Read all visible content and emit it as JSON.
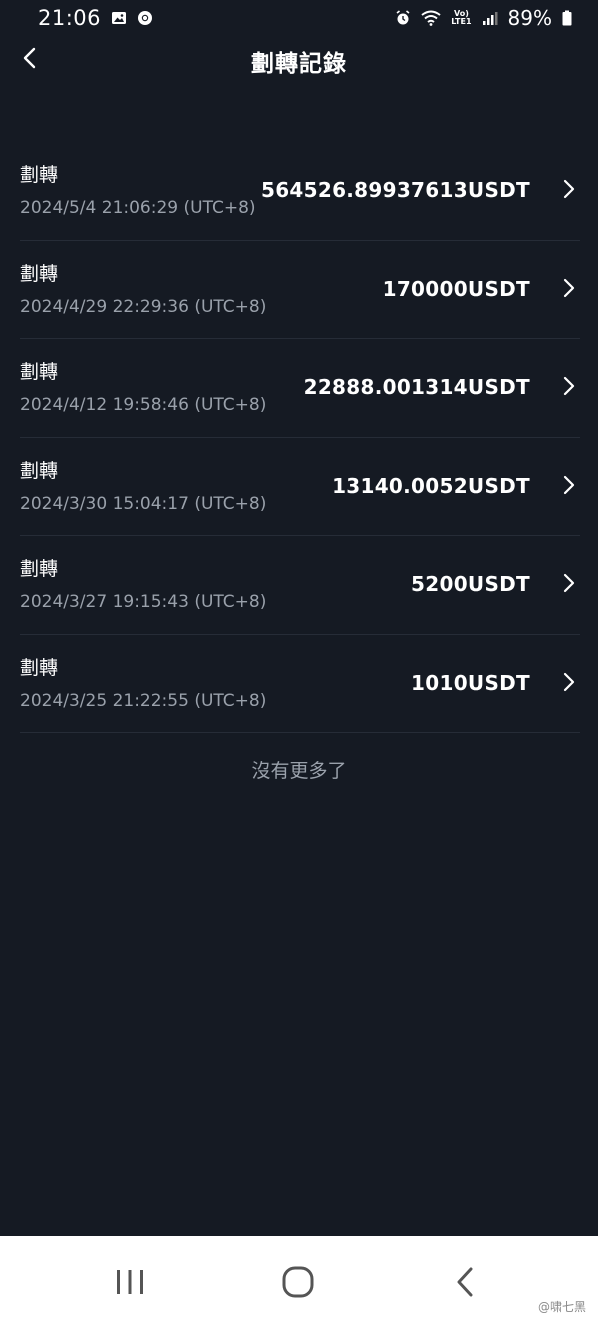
{
  "status_bar": {
    "time": "21:06",
    "network": "LTE1",
    "volte": "Vo)",
    "battery": "89%"
  },
  "header": {
    "title": "劃轉記錄"
  },
  "records": [
    {
      "type": "劃轉",
      "time": "2024/5/4 21:06:29 (UTC+8)",
      "amount": "564526.89937613USDT"
    },
    {
      "type": "劃轉",
      "time": "2024/4/29 22:29:36 (UTC+8)",
      "amount": "170000USDT"
    },
    {
      "type": "劃轉",
      "time": "2024/4/12 19:58:46 (UTC+8)",
      "amount": "22888.001314USDT"
    },
    {
      "type": "劃轉",
      "time": "2024/3/30 15:04:17 (UTC+8)",
      "amount": "13140.0052USDT"
    },
    {
      "type": "劃轉",
      "time": "2024/3/27 19:15:43 (UTC+8)",
      "amount": "5200USDT"
    },
    {
      "type": "劃轉",
      "time": "2024/3/25 21:22:55 (UTC+8)",
      "amount": "1010USDT"
    }
  ],
  "list_end_text": "沒有更多了",
  "nav_watermark": "@啸七黑",
  "icons": {
    "back": "chevron-left-icon",
    "row": "chevron-right-icon"
  },
  "colors": {
    "background": "#151a23",
    "divider": "#262c37",
    "secondary_text": "#9aa1ab"
  }
}
